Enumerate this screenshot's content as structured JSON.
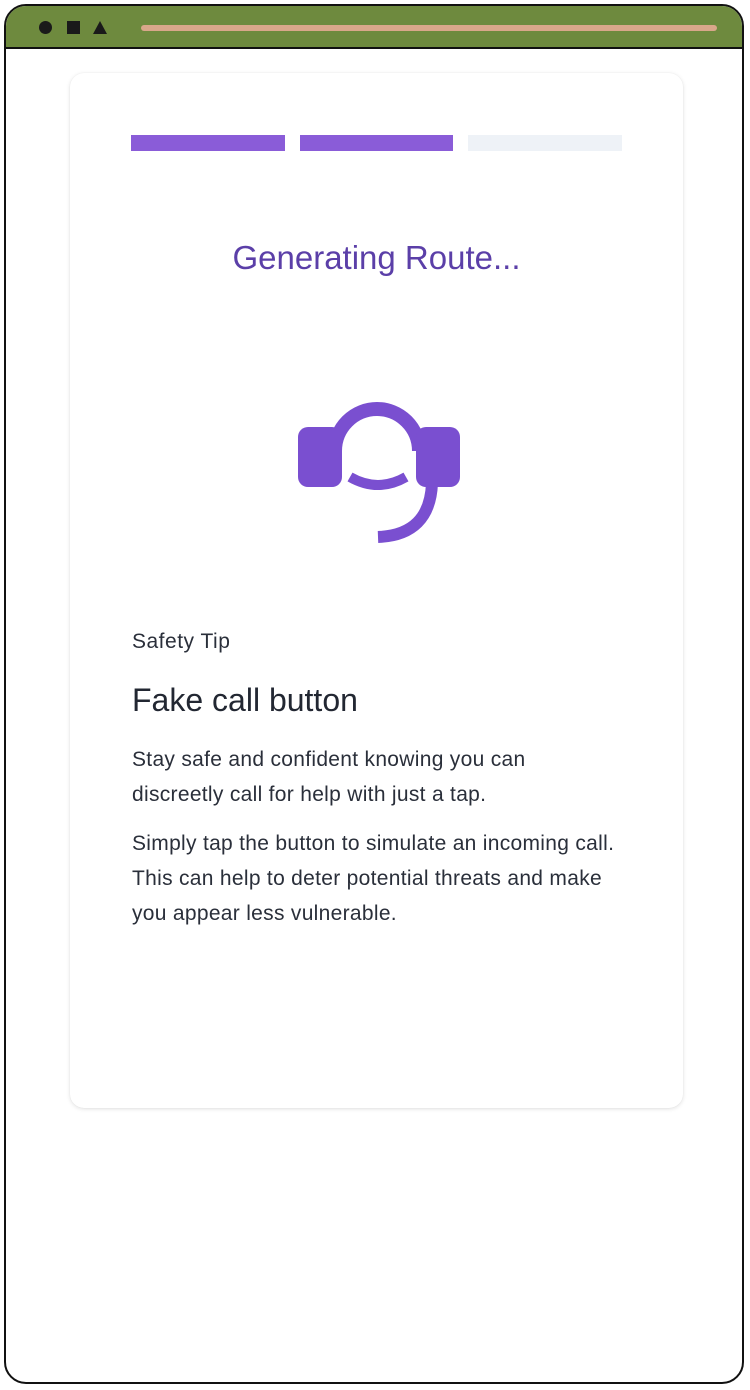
{
  "colors": {
    "accent": "#8a5cd8",
    "title": "#5b3fa8",
    "icon": "#7a4fd0",
    "progress_inactive": "#eef2f7",
    "titlebar": "#6e8a3e"
  },
  "progress": {
    "total_steps": 3,
    "completed_steps": 2
  },
  "screen": {
    "title": "Generating Route...",
    "icon": "headset-icon"
  },
  "tip": {
    "label": "Safety Tip",
    "heading": "Fake call button",
    "paragraphs": [
      "Stay safe and confident knowing you can discreetly call for help with just a tap.",
      "Simply tap the button to simulate an incoming call. This can help to deter potential threats and make you appear less vulnerable."
    ]
  }
}
